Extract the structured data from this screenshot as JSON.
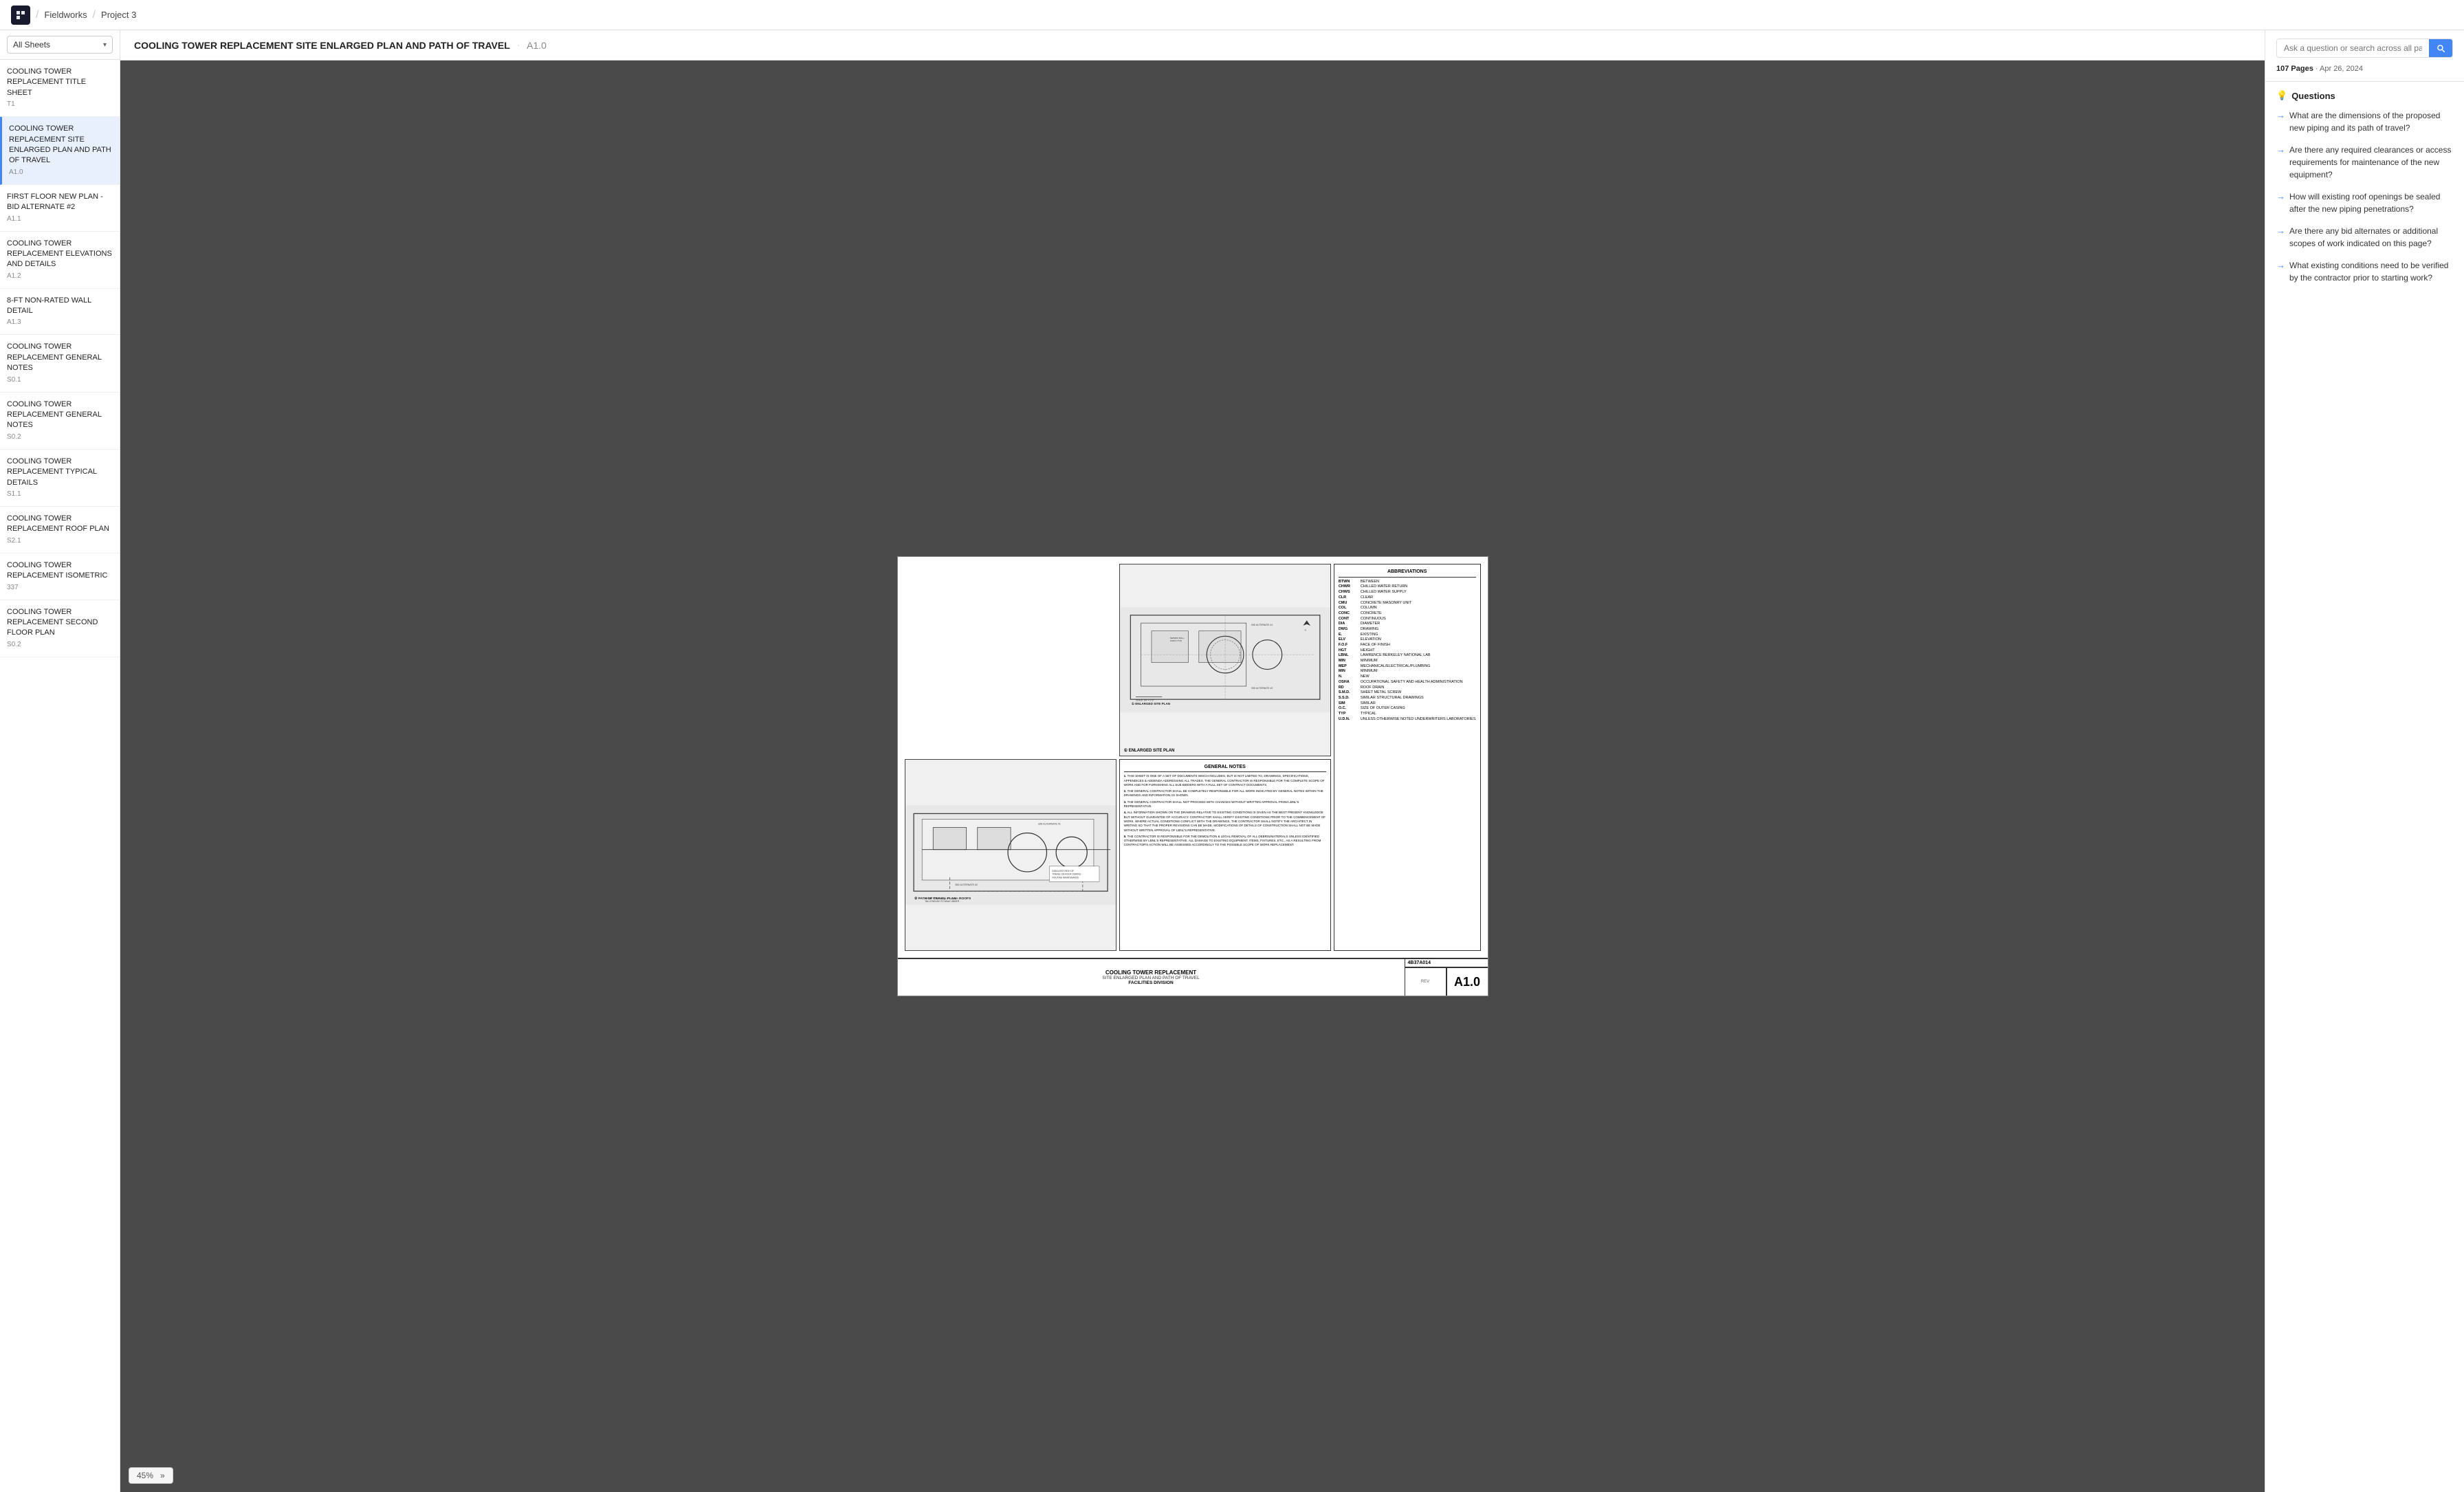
{
  "nav": {
    "logo_alt": "Fieldworks Logo",
    "breadcrumbs": [
      "Fieldworks",
      "Project 3"
    ]
  },
  "sidebar": {
    "selector_label": "All Sheets",
    "items": [
      {
        "id": "T1",
        "title": "COOLING TOWER REPLACEMENT TITLE SHEET",
        "code": "T1"
      },
      {
        "id": "A1.0",
        "title": "COOLING TOWER REPLACEMENT SITE ENLARGED PLAN AND PATH OF TRAVEL",
        "code": "A1.0",
        "active": true
      },
      {
        "id": "A1.1",
        "title": "FIRST FLOOR NEW PLAN - BID ALTERNATE #2",
        "code": "A1.1"
      },
      {
        "id": "A1.2",
        "title": "COOLING TOWER REPLACEMENT ELEVATIONS AND DETAILS",
        "code": "A1.2"
      },
      {
        "id": "A1.3",
        "title": "8-FT NON-RATED WALL DETAIL",
        "code": "A1.3"
      },
      {
        "id": "S0.1",
        "title": "COOLING TOWER REPLACEMENT GENERAL NOTES",
        "code": "S0.1"
      },
      {
        "id": "S0.2",
        "title": "COOLING TOWER REPLACEMENT GENERAL NOTES",
        "code": "S0.2"
      },
      {
        "id": "S1.1",
        "title": "COOLING TOWER REPLACEMENT TYPICAL DETAILS",
        "code": "S1.1"
      },
      {
        "id": "S2.1",
        "title": "COOLING TOWER REPLACEMENT ROOF PLAN",
        "code": "S2.1"
      },
      {
        "id": "337",
        "title": "COOLING TOWER REPLACEMENT ISOMETRIC",
        "code": "337"
      },
      {
        "id": "S0.2b",
        "title": "COOLING TOWER REPLACEMENT SECOND FLOOR PLAN",
        "code": "S0.2"
      }
    ]
  },
  "content_header": {
    "title": "COOLING TOWER REPLACEMENT SITE ENLARGED PLAN AND PATH OF TRAVEL",
    "dot": "·",
    "sheet_id": "A1.0"
  },
  "drawing": {
    "abbreviations_title": "ABBREVIATIONS",
    "abbreviations": [
      [
        "BTWN",
        "BETWEEN"
      ],
      [
        "CHWR",
        "CHILLED WATER RETURN"
      ],
      [
        "CHWS",
        "CHILLED WATER SUPPLY"
      ],
      [
        "CLR",
        "CLEAR"
      ],
      [
        "CMU",
        "CONCRETE MASONRY UNIT"
      ],
      [
        "COL",
        "COLUMN"
      ],
      [
        "CONC",
        "CONCRETE"
      ],
      [
        "CONT",
        "CONTINUOUS"
      ],
      [
        "DIA",
        "DIAMETER"
      ],
      [
        "DWG",
        "DRAWING"
      ],
      [
        "E.",
        "EXISTING"
      ],
      [
        "ELV",
        "ELEVATION"
      ],
      [
        "F.O.F",
        "FACE OF FINISH"
      ],
      [
        "HGT",
        "HEIGHT"
      ],
      [
        "LBNL",
        "LAWRENCE BERKELEY NATIONAL LAB"
      ],
      [
        "MIN",
        "MINIMUM"
      ],
      [
        "MEP",
        "MECHANICAL/ELECTRICAL/PLUMBING"
      ],
      [
        "MIN",
        "MINIMUM"
      ],
      [
        "N.",
        "NEW"
      ],
      [
        "OSHA",
        "OCCUPATIONAL SAFETY AND HEALTH ADMINISTRATION"
      ],
      [
        "RD",
        "ROOF DRAIN"
      ],
      [
        "S.M.D.",
        "SHEET METAL SCREW"
      ],
      [
        "S.S.D.",
        "SIMILAR STRUCTURAL DRAWINGS"
      ],
      [
        "SIM",
        "SIMILAR"
      ],
      [
        "O.C.",
        "SIZE OF OUTER CASING"
      ],
      [
        "TYP",
        "TYPICAL"
      ],
      [
        "U.D.N.",
        "UNLESS OTHERWISE NOTED UNDERWRITERS LABORATORIES"
      ]
    ],
    "plan1_label": "① ENLARGED SITE PLAN",
    "plan2_label": "② PATH OF TRAVEL PLAN - ROOFS",
    "general_notes_title": "GENERAL NOTES",
    "general_notes": [
      "THIS SHEET IS ONE OF A SET OF DOCUMENTS WHICH INCLUDES, BUT IS NOT LIMITED TO, DRAWINGS, SPECIFICATIONS, APPENDICES & ADDENDA ADDRESSING ALL TRADES. THE GENERAL CONTRACTOR IS RESPONSIBLE FOR THE COMPLETE SCOPE OF WORK AND FOR FURNISHING ALL SUB BIDDERS WITH A FULL SET OF CONTRACT DOCUMENTS.",
      "THE GENERAL CONTRACTOR SHALL BE COMPLETELY RESPONSIBLE FOR ALL WORK INDICATED BY GENERAL NOTES WITHIN THE DRAWINGS AND INFORMATION AS SHOWN.",
      "THE GENERAL CONTRACTOR SHALL NOT PROCEED WITH CHANGES WITHOUT WRITTEN APPROVAL FROM LBNL'S REPRESENTATIVE.",
      "ALL INFORMATION SHOWN ON THE DRAWING RELATIVE TO EXISTING CONDITIONS IS GIVEN AS THE BEST PRESENT KNOWLEDGE BUT WITHOUT GUARANTEE OF ACCURACY. CONTRACTOR SHALL VERIFY EXISTING CONDITIONS PRIOR TO THE COMMENCEMENT OF WORK. WHERE ACTUAL CONDITIONS CONFLICT WITH THE DRAWINGS, THE CONTRACTOR SHALL NOTIFY THE ARCHITECT IN WRITING SO THAT THE PROPER REVISIONS CAN BE MADE. MODIFICATIONS OF DETAILS OF CONSTRUCTION SHALL NOT BE MADE WITHOUT WRITTEN APPROVAL OF LBNL'S REPRESENTATIVE.",
      "THE CONTRACTOR IS RESPONSIBLE FOR THE DEMOLITION & LEGAL REMOVAL OF ALL DEBRIS/MATERIALS UNLESS IDENTIFIED OTHERWISE BY LBNL'S REPRESENTATIVE. ALL DAMAGE TO EXISTING EQUIPMENT, ITEMS, FIXTURES, ETC., AS A RESULTING FROM CONTRACTOR'S ACTION WILL BE ASSESSED ACCORDINGLY TO THE POSSIBLE SCOPE OF WORK REPLACEMENT."
    ],
    "title_block": {
      "project_name": "COOLING TOWER REPLACEMENT",
      "sheet_desc": "SITE ENLARGED PLAN AND PATH OF TRAVEL",
      "division": "FACILITIES DIVISION",
      "project_code": "4B37A014",
      "sheet_number": "A1.0"
    },
    "zoom_level": "45%"
  },
  "right_panel": {
    "search_placeholder": "Ask a question or search across all pages...",
    "pages_count": "107 Pages",
    "date": "Apr 26, 2024",
    "questions_title": "Questions",
    "questions": [
      "What are the dimensions of the proposed new piping and its path of travel?",
      "Are there any required clearances or access requirements for maintenance of the new equipment?",
      "How will existing roof openings be sealed after the new piping penetrations?",
      "Are there any bid alternates or additional scopes of work indicated on this page?",
      "What existing conditions need to be verified by the contractor prior to starting work?"
    ]
  }
}
